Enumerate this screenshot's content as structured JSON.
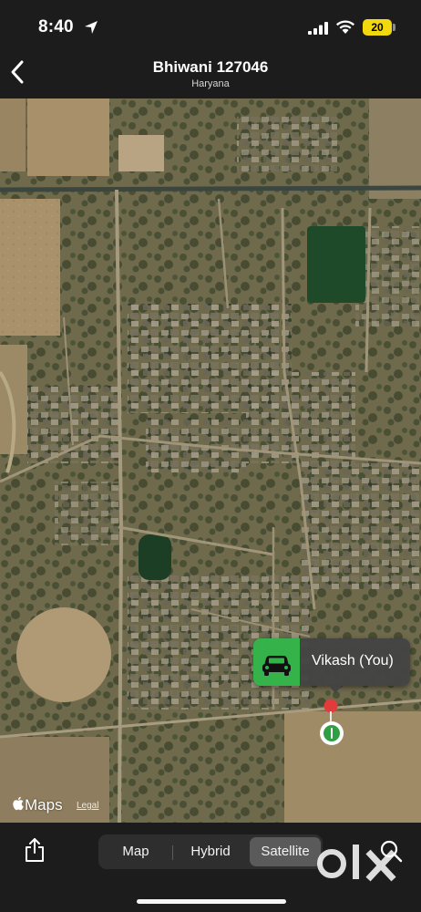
{
  "status_bar": {
    "time": "8:40",
    "battery": "20"
  },
  "header": {
    "title": "Bhiwani 127046",
    "subtitle": "Haryana"
  },
  "map": {
    "type": "satellite",
    "callout": {
      "label": "Vikash (You)",
      "icon": "car-icon",
      "accent": "#36b24a"
    },
    "attribution": {
      "brand": "Maps",
      "legal": "Legal"
    }
  },
  "toolbar": {
    "map_types": [
      "Map",
      "Hybrid",
      "Satellite"
    ],
    "selected": "Satellite"
  },
  "watermark": "olx",
  "colors": {
    "pin_red": "#e23b3b",
    "user_green": "#2ea043",
    "bar_bg": "#1c1c1c"
  }
}
